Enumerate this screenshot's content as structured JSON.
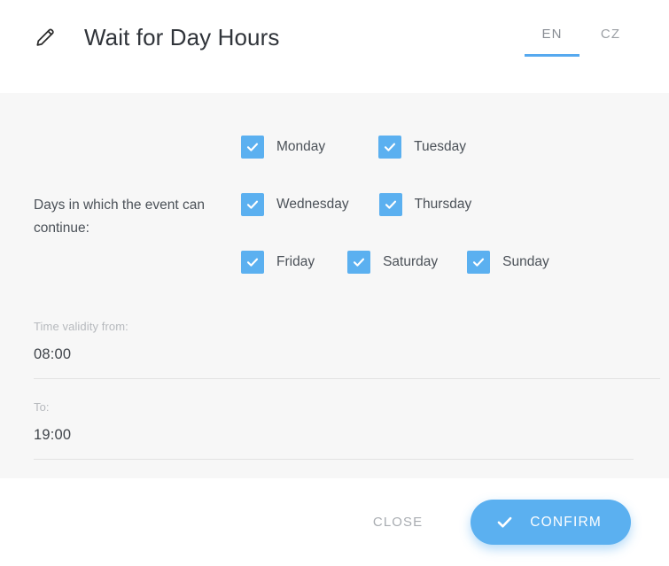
{
  "header": {
    "edit_icon": "pencil-icon",
    "title": "Wait for Day Hours",
    "tabs": [
      {
        "label": "EN",
        "active": true
      },
      {
        "label": "CZ",
        "active": false
      }
    ]
  },
  "form": {
    "days_label": "Days in which the event can continue:",
    "days": [
      {
        "label": "Monday",
        "checked": true
      },
      {
        "label": "Tuesday",
        "checked": true
      },
      {
        "label": "Wednesday",
        "checked": true
      },
      {
        "label": "Thursday",
        "checked": true
      },
      {
        "label": "Friday",
        "checked": true
      },
      {
        "label": "Saturday",
        "checked": true
      },
      {
        "label": "Sunday",
        "checked": true
      }
    ],
    "time_from": {
      "label": "Time validity from:",
      "value": "08:00"
    },
    "time_to": {
      "label": "To:",
      "value": "19:00"
    }
  },
  "footer": {
    "close_label": "CLOSE",
    "confirm_label": "CONFIRM",
    "confirm_icon": "check-icon"
  },
  "colors": {
    "accent": "#5bb0f0",
    "tab_underline": "#56a9ef",
    "body_bg": "#f7f7f7",
    "panel_bg": "#ffffff",
    "text_primary": "#4b5158",
    "text_muted": "#b6b9bd",
    "divider": "#e2e2e2"
  }
}
